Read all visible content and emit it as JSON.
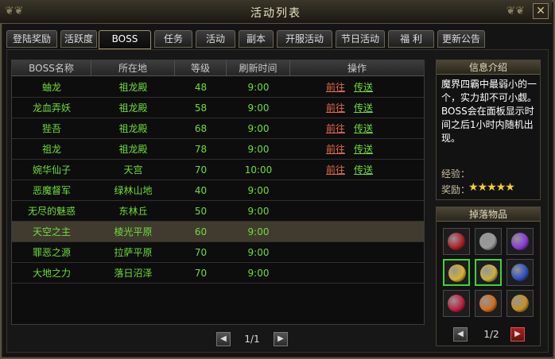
{
  "window": {
    "title": "活动列表",
    "close_icon": "close-icon"
  },
  "tabs": [
    {
      "label": "登陆奖励"
    },
    {
      "label": "活跃度"
    },
    {
      "label": "BOSS",
      "active": true
    },
    {
      "label": "任务"
    },
    {
      "label": "活动"
    },
    {
      "label": "副本"
    },
    {
      "label": "开服活动"
    },
    {
      "label": "节日活动"
    },
    {
      "label": "福 利"
    },
    {
      "label": "更新公告"
    }
  ],
  "table": {
    "headers": [
      "BOSS名称",
      "所在地",
      "等级",
      "刷新时间",
      "操作"
    ],
    "action_go": "前往",
    "action_teleport": "传送",
    "rows": [
      {
        "name": "蚰龙",
        "location": "祖龙殿",
        "level": "48",
        "time": "9:00",
        "actions": true
      },
      {
        "name": "龙血弄妖",
        "location": "祖龙殿",
        "level": "58",
        "time": "9:00",
        "actions": true
      },
      {
        "name": "狴吾",
        "location": "祖龙殿",
        "level": "68",
        "time": "9:00",
        "actions": true
      },
      {
        "name": "祖龙",
        "location": "祖龙殿",
        "level": "78",
        "time": "9:00",
        "actions": true
      },
      {
        "name": "婉华仙子",
        "location": "天宫",
        "level": "70",
        "time": "10:00",
        "actions": true
      },
      {
        "name": "恶魔督军",
        "location": "绿林山地",
        "level": "40",
        "time": "9:00",
        "actions": false
      },
      {
        "name": "无尽的魅惑",
        "location": "东林丘",
        "level": "50",
        "time": "9:00",
        "actions": false
      },
      {
        "name": "天空之主",
        "location": "棱光平原",
        "level": "60",
        "time": "9:00",
        "actions": false,
        "selected": true
      },
      {
        "name": "罪恶之源",
        "location": "拉萨平原",
        "level": "70",
        "time": "9:00",
        "actions": false
      },
      {
        "name": "大地之力",
        "location": "落日沼泽",
        "level": "70",
        "time": "9:00",
        "actions": false
      }
    ],
    "pager": {
      "text": "1/1"
    }
  },
  "info": {
    "title": "信息介绍",
    "description": "魔界四霸中最弱小的一个，实力却不可小觑。BOSS会在面板显示时间之后1小时内随机出现。",
    "exp_label": "经验：",
    "reward_label": "奖励：",
    "stars": 5
  },
  "drops": {
    "title": "掉落物品",
    "pager": {
      "text": "1/2"
    },
    "items": [
      {
        "icon": "red-gem-icon",
        "color": "#b0202a",
        "green": false
      },
      {
        "icon": "steel-box-icon",
        "color": "#9a9a9a",
        "green": false
      },
      {
        "icon": "purple-orb-icon",
        "color": "#8a3ad8",
        "green": false
      },
      {
        "icon": "gold-scroll-icon",
        "color": "#d8b030",
        "green": true
      },
      {
        "icon": "gold-card-icon",
        "color": "#c8b040",
        "green": true
      },
      {
        "icon": "blue-beast-icon",
        "color": "#3050c0",
        "green": false
      },
      {
        "icon": "red-crystal-icon",
        "color": "#c02040",
        "green": false
      },
      {
        "icon": "gold-medal-icon",
        "color": "#d07020",
        "green": false
      },
      {
        "icon": "gold-coin-icon",
        "color": "#c89020",
        "green": false
      }
    ]
  }
}
